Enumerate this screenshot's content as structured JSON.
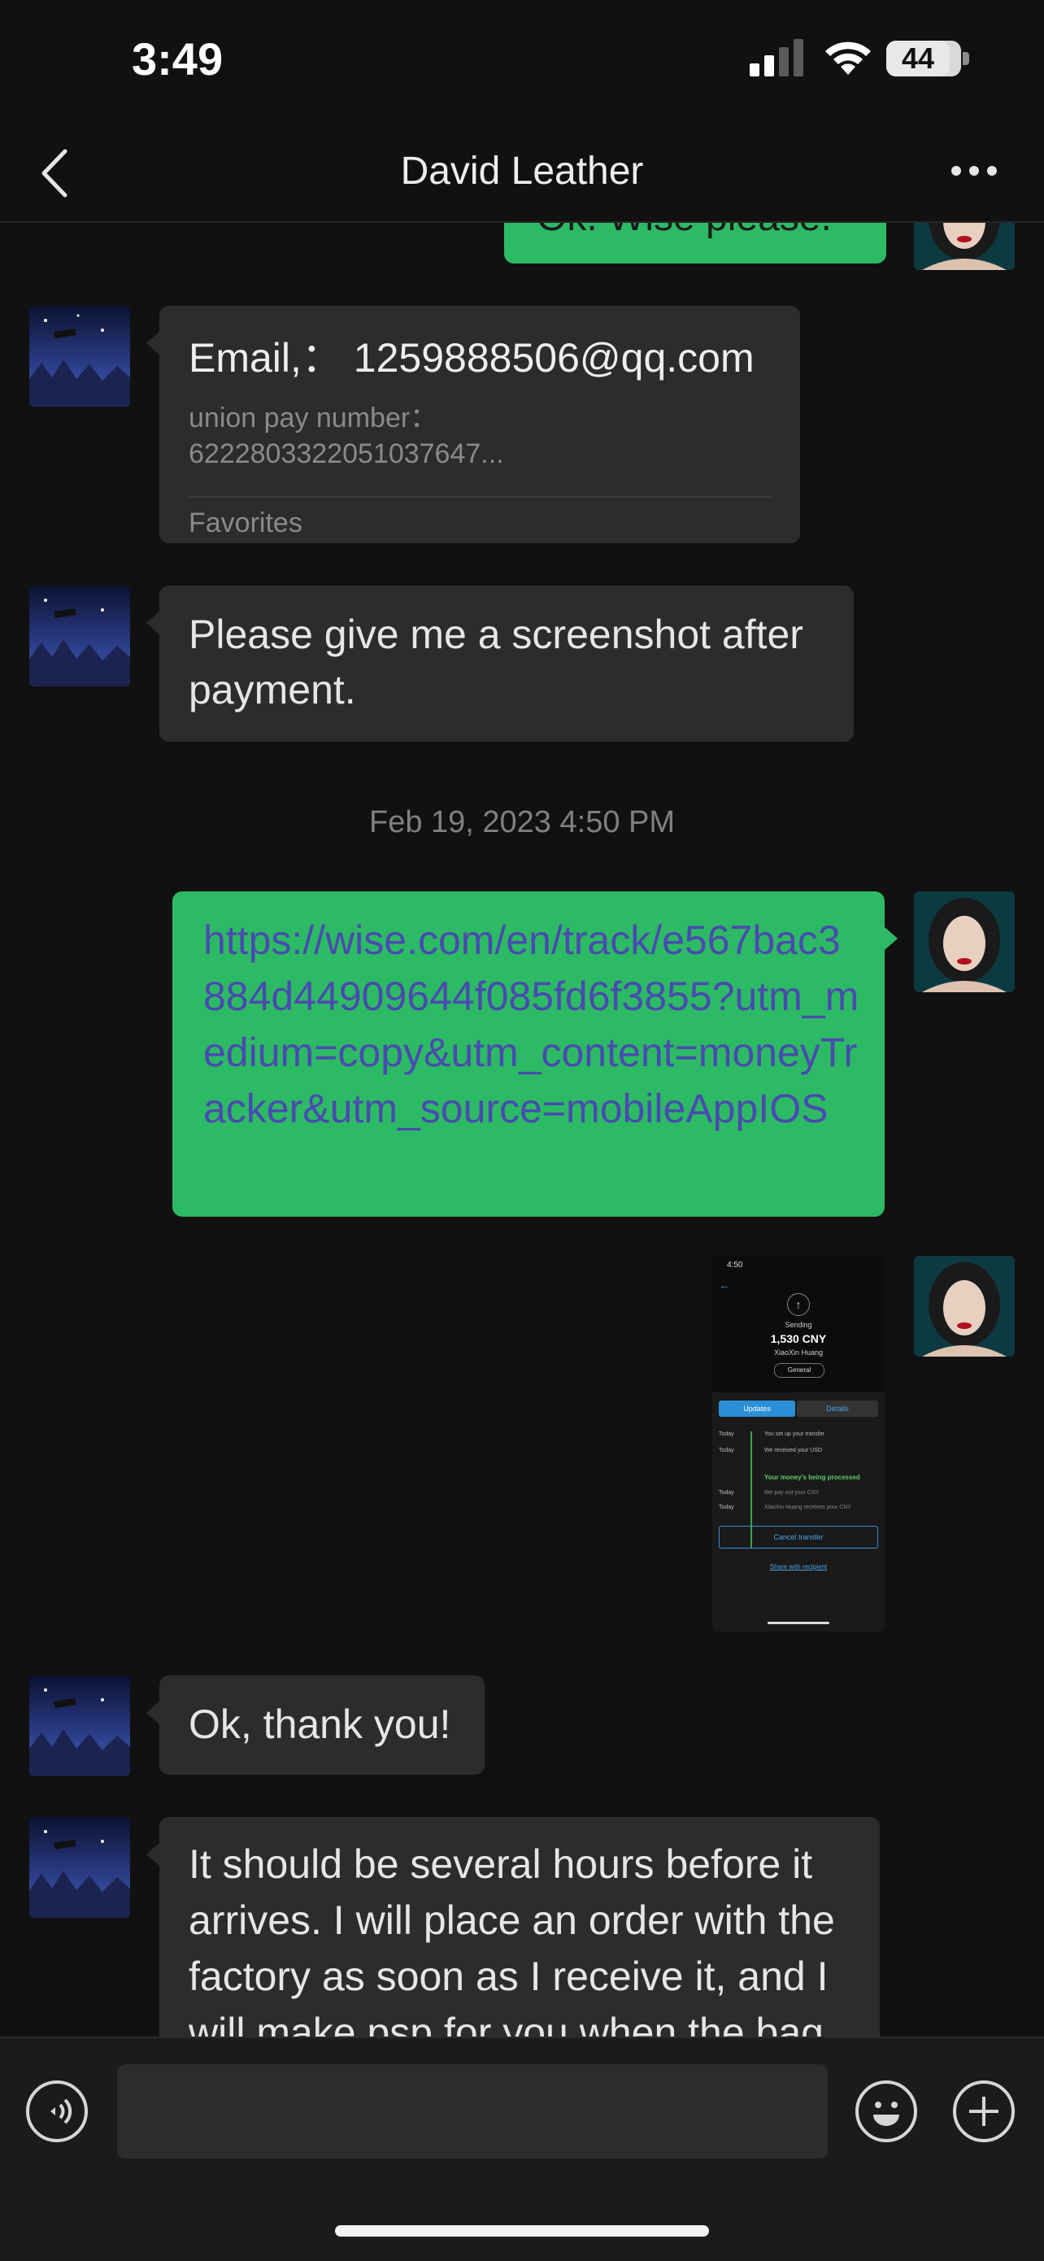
{
  "status_bar": {
    "time": "3:49",
    "battery": "44"
  },
  "nav": {
    "title": "David Leather"
  },
  "messages": {
    "partial_top": {
      "text": "Ok. Wise please."
    },
    "card": {
      "title": "Email,：  1259888506@qq.com",
      "subtitle_line1": "union pay number：",
      "subtitle_line2": "6222803322051037647...",
      "footer": "Favorites"
    },
    "screenshot_request": {
      "text": "Please give me a screenshot after payment."
    },
    "timestamp": "Feb 19, 2023 4:50 PM",
    "link": {
      "text": "https://wise.com/en/track/e567bac3884d44909644f085fd6f3855?utm_medium=copy&utm_content=moneyTracker&utm_source=mobileAppIOS"
    },
    "screenshot_thumb": {
      "time": "4:50",
      "sending": "Sending",
      "amount": "1,530 CNY",
      "recipient": "XiaoXin Huang",
      "pill": "General",
      "tab_updates": "Updates",
      "tab_details": "Details",
      "steps": [
        {
          "day": "Today",
          "text": "You set up your transfer"
        },
        {
          "day": "Today",
          "text": "We received your USD"
        },
        {
          "day": "",
          "text": "Your money's being processed"
        },
        {
          "day": "Today",
          "text": "We pay out your CNY"
        },
        {
          "day": "Today",
          "text": "XiaoXin Huang receives your CNY"
        }
      ],
      "cancel": "Cancel transfer",
      "share": "Share with recipient"
    },
    "thanks": {
      "text": "Ok, thank you!"
    },
    "several_hours": {
      "text": "It should be several hours before it arrives. I will place an order with the factory as soon as I receive it, and I will make psp for you when the bag"
    }
  },
  "colors": {
    "green_bubble": "#2dba64",
    "gray_bubble": "#2c2c2c",
    "link_text": "#4a4ab0",
    "background": "#111111"
  },
  "icons": [
    "back-chevron-icon",
    "more-icon",
    "voice-icon",
    "emoji-icon",
    "plus-icon"
  ]
}
